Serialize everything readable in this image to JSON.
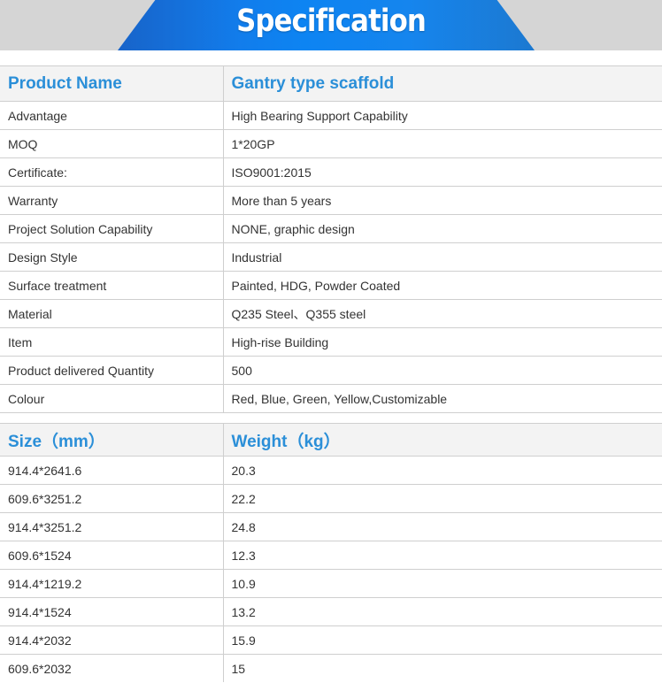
{
  "banner": {
    "title": "Specification"
  },
  "specs": {
    "header": [
      "Product Name",
      "Gantry type scaffold"
    ],
    "rows": [
      [
        "Advantage",
        "High Bearing Support Capability"
      ],
      [
        "MOQ",
        "1*20GP"
      ],
      [
        "Certificate:",
        "ISO9001:2015"
      ],
      [
        "Warranty",
        "More than 5 years"
      ],
      [
        "Project Solution Capability",
        "NONE, graphic design"
      ],
      [
        "Design Style",
        "Industrial"
      ],
      [
        "Surface treatment",
        "Painted, HDG, Powder Coated"
      ],
      [
        "Material",
        "Q235 Steel、Q355 steel"
      ],
      [
        "Item",
        "High-rise Building"
      ],
      [
        "Product delivered Quantity",
        "500"
      ],
      [
        "Colour",
        "Red, Blue, Green, Yellow,Customizable"
      ]
    ]
  },
  "sizes": {
    "header": [
      "Size（mm）",
      "Weight（kg）"
    ],
    "rows": [
      [
        "914.4*2641.6",
        "20.3"
      ],
      [
        "609.6*3251.2",
        "22.2"
      ],
      [
        "914.4*3251.2",
        "24.8"
      ],
      [
        "609.6*1524",
        "12.3"
      ],
      [
        "914.4*1219.2",
        "10.9"
      ],
      [
        "914.4*1524",
        "13.2"
      ],
      [
        "914.4*2032",
        "15.9"
      ],
      [
        "609.6*2032",
        "15"
      ]
    ]
  },
  "colors": {
    "accent": "#2b8fd8",
    "banner": "#0d84f2",
    "border": "#cfcfcf"
  }
}
